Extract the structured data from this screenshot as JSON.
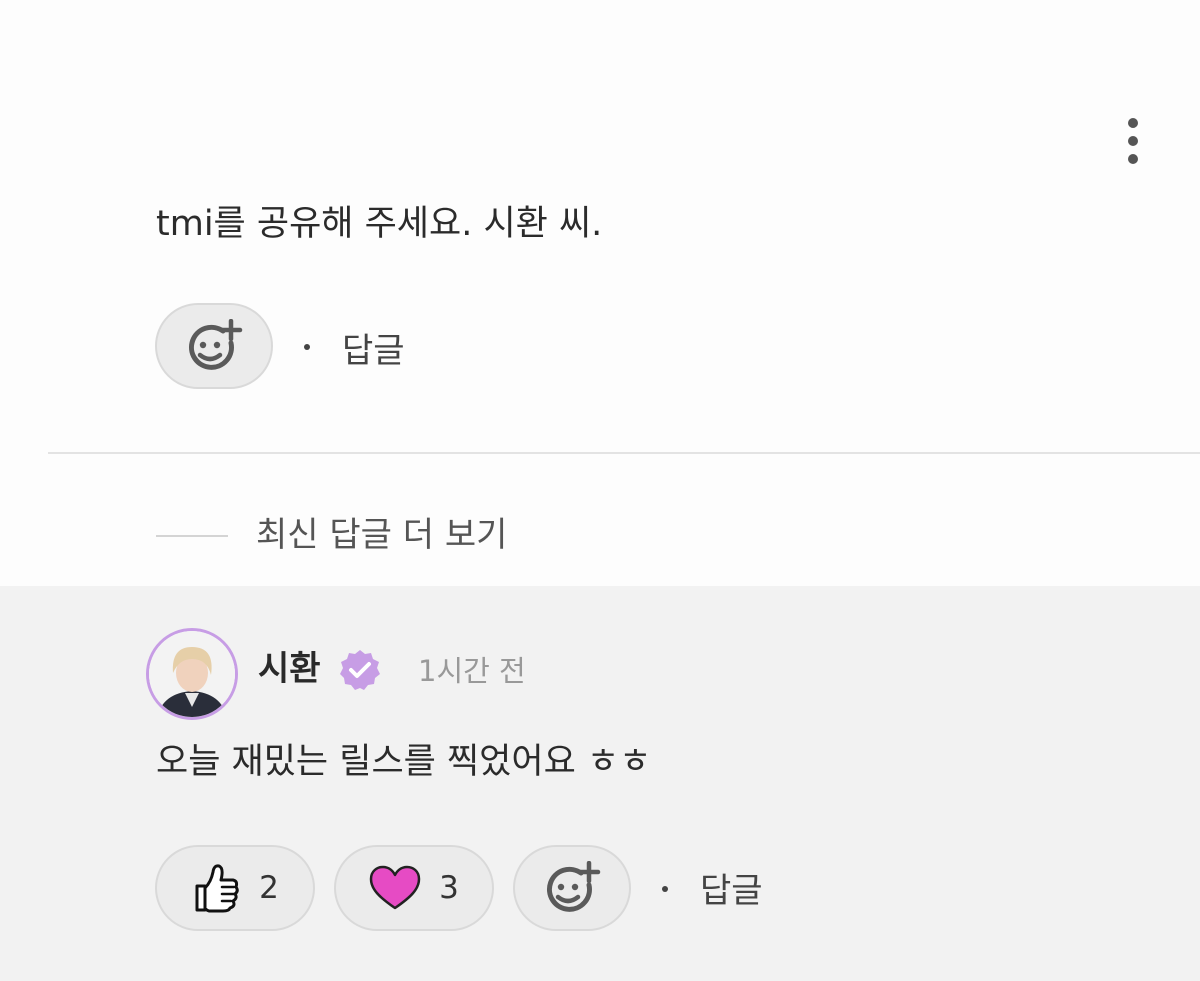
{
  "comment": {
    "text": "tmi를 공유해 주세요. 시환 씨.",
    "reply_label": "답글",
    "add_reaction_icon": "smiley-plus-icon",
    "menu_icon": "more-vertical-icon"
  },
  "more_replies": {
    "label": "최신 답글 더 보기"
  },
  "reply": {
    "author": "시환",
    "verified_icon": "verified-badge-icon",
    "timestamp": "1시간 전",
    "text": "오늘 재밌는 릴스를 찍었어요 ㅎㅎ",
    "reactions": [
      {
        "icon": "thumbs-up-icon",
        "count": "2"
      },
      {
        "icon": "heart-icon",
        "count": "3",
        "color": "#e64bc4"
      }
    ],
    "add_reaction_icon": "smiley-plus-icon",
    "reply_label": "답글"
  },
  "colors": {
    "reply_background": "#f2f2f2",
    "verified": "#c79de5",
    "avatar_ring": "#c79de5",
    "heart": "#e64bc4"
  }
}
